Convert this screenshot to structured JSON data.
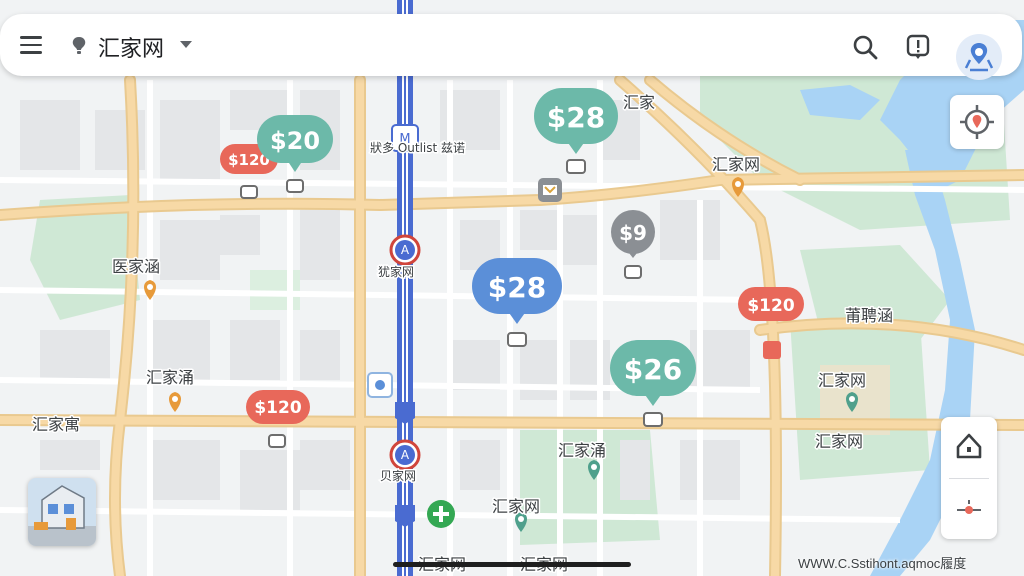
{
  "header": {
    "app_title": "汇家网",
    "menu_icon": "menu-icon",
    "logo_icon": "lightbulb-pin-icon",
    "actions": [
      "search-icon",
      "info-icon",
      "location-avatar-icon"
    ]
  },
  "price_markers": [
    {
      "label": "$120",
      "color": "#e8685a",
      "style": "small"
    },
    {
      "label": "$20",
      "color": "#6cb9a9",
      "style": "medium"
    },
    {
      "label": "$28",
      "color": "#6cb9a9",
      "style": "large"
    },
    {
      "label": "$9",
      "color": "#8b8f94",
      "style": "small"
    },
    {
      "label": "$28",
      "color": "#5b8fd8",
      "style": "large"
    },
    {
      "label": "$120",
      "color": "#e8685a",
      "style": "small"
    },
    {
      "label": "$26",
      "color": "#6cb9a9",
      "style": "large"
    },
    {
      "label": "$120",
      "color": "#e8685a",
      "style": "small"
    }
  ],
  "place_labels": [
    "汇家",
    "汇家网",
    "医家涵",
    "莆聘涵",
    "汇家网",
    "汇家涌",
    "汇家网",
    "汇家涌",
    "汇家寓",
    "汇家网",
    "汇家网",
    "汇家网",
    "汇家网",
    "汇家网",
    "汇家网",
    "汇家网"
  ],
  "transit_labels": [
    "狀多 Outlist 兹诺",
    "犹家网",
    "贝家网"
  ],
  "controls": {
    "my_location_icon": "crosshair-target-icon",
    "home_icon": "home-icon",
    "compass_icon": "compass-icon"
  },
  "attribution": "WWW.C.Sstihont.aqmoc履度",
  "colors": {
    "water": "#a9d3f5",
    "park": "#cfe8d5",
    "major_road": "#f7d9a6",
    "rail": "#4a6bd1",
    "red_marker": "#e8685a",
    "teal_marker": "#6cb9a9",
    "blue_marker": "#5b8fd8",
    "gray_marker": "#8b8f94"
  }
}
